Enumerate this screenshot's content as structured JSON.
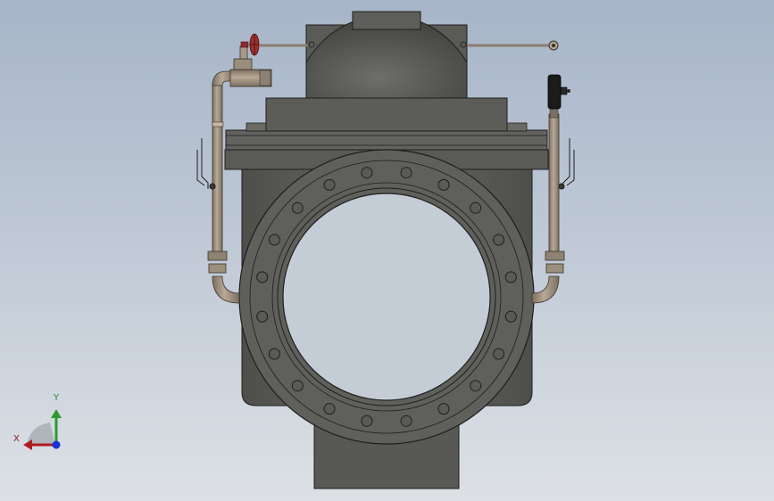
{
  "viewport": {
    "background_top": "#a7b5c8",
    "background_bottom": "#dde1e5"
  },
  "model": {
    "body_color": "#5f5f5c",
    "edge_color": "#1e1e1c",
    "pipe_color": "#a89a86",
    "handwheel_color": "#8e2a2a",
    "gauge_color": "#1b1b1b"
  },
  "triad": {
    "x_label": "X",
    "y_label": "Y",
    "x_color": "#b01c1c",
    "y_color": "#2e9a2e",
    "z_color": "#1a2fd6"
  }
}
